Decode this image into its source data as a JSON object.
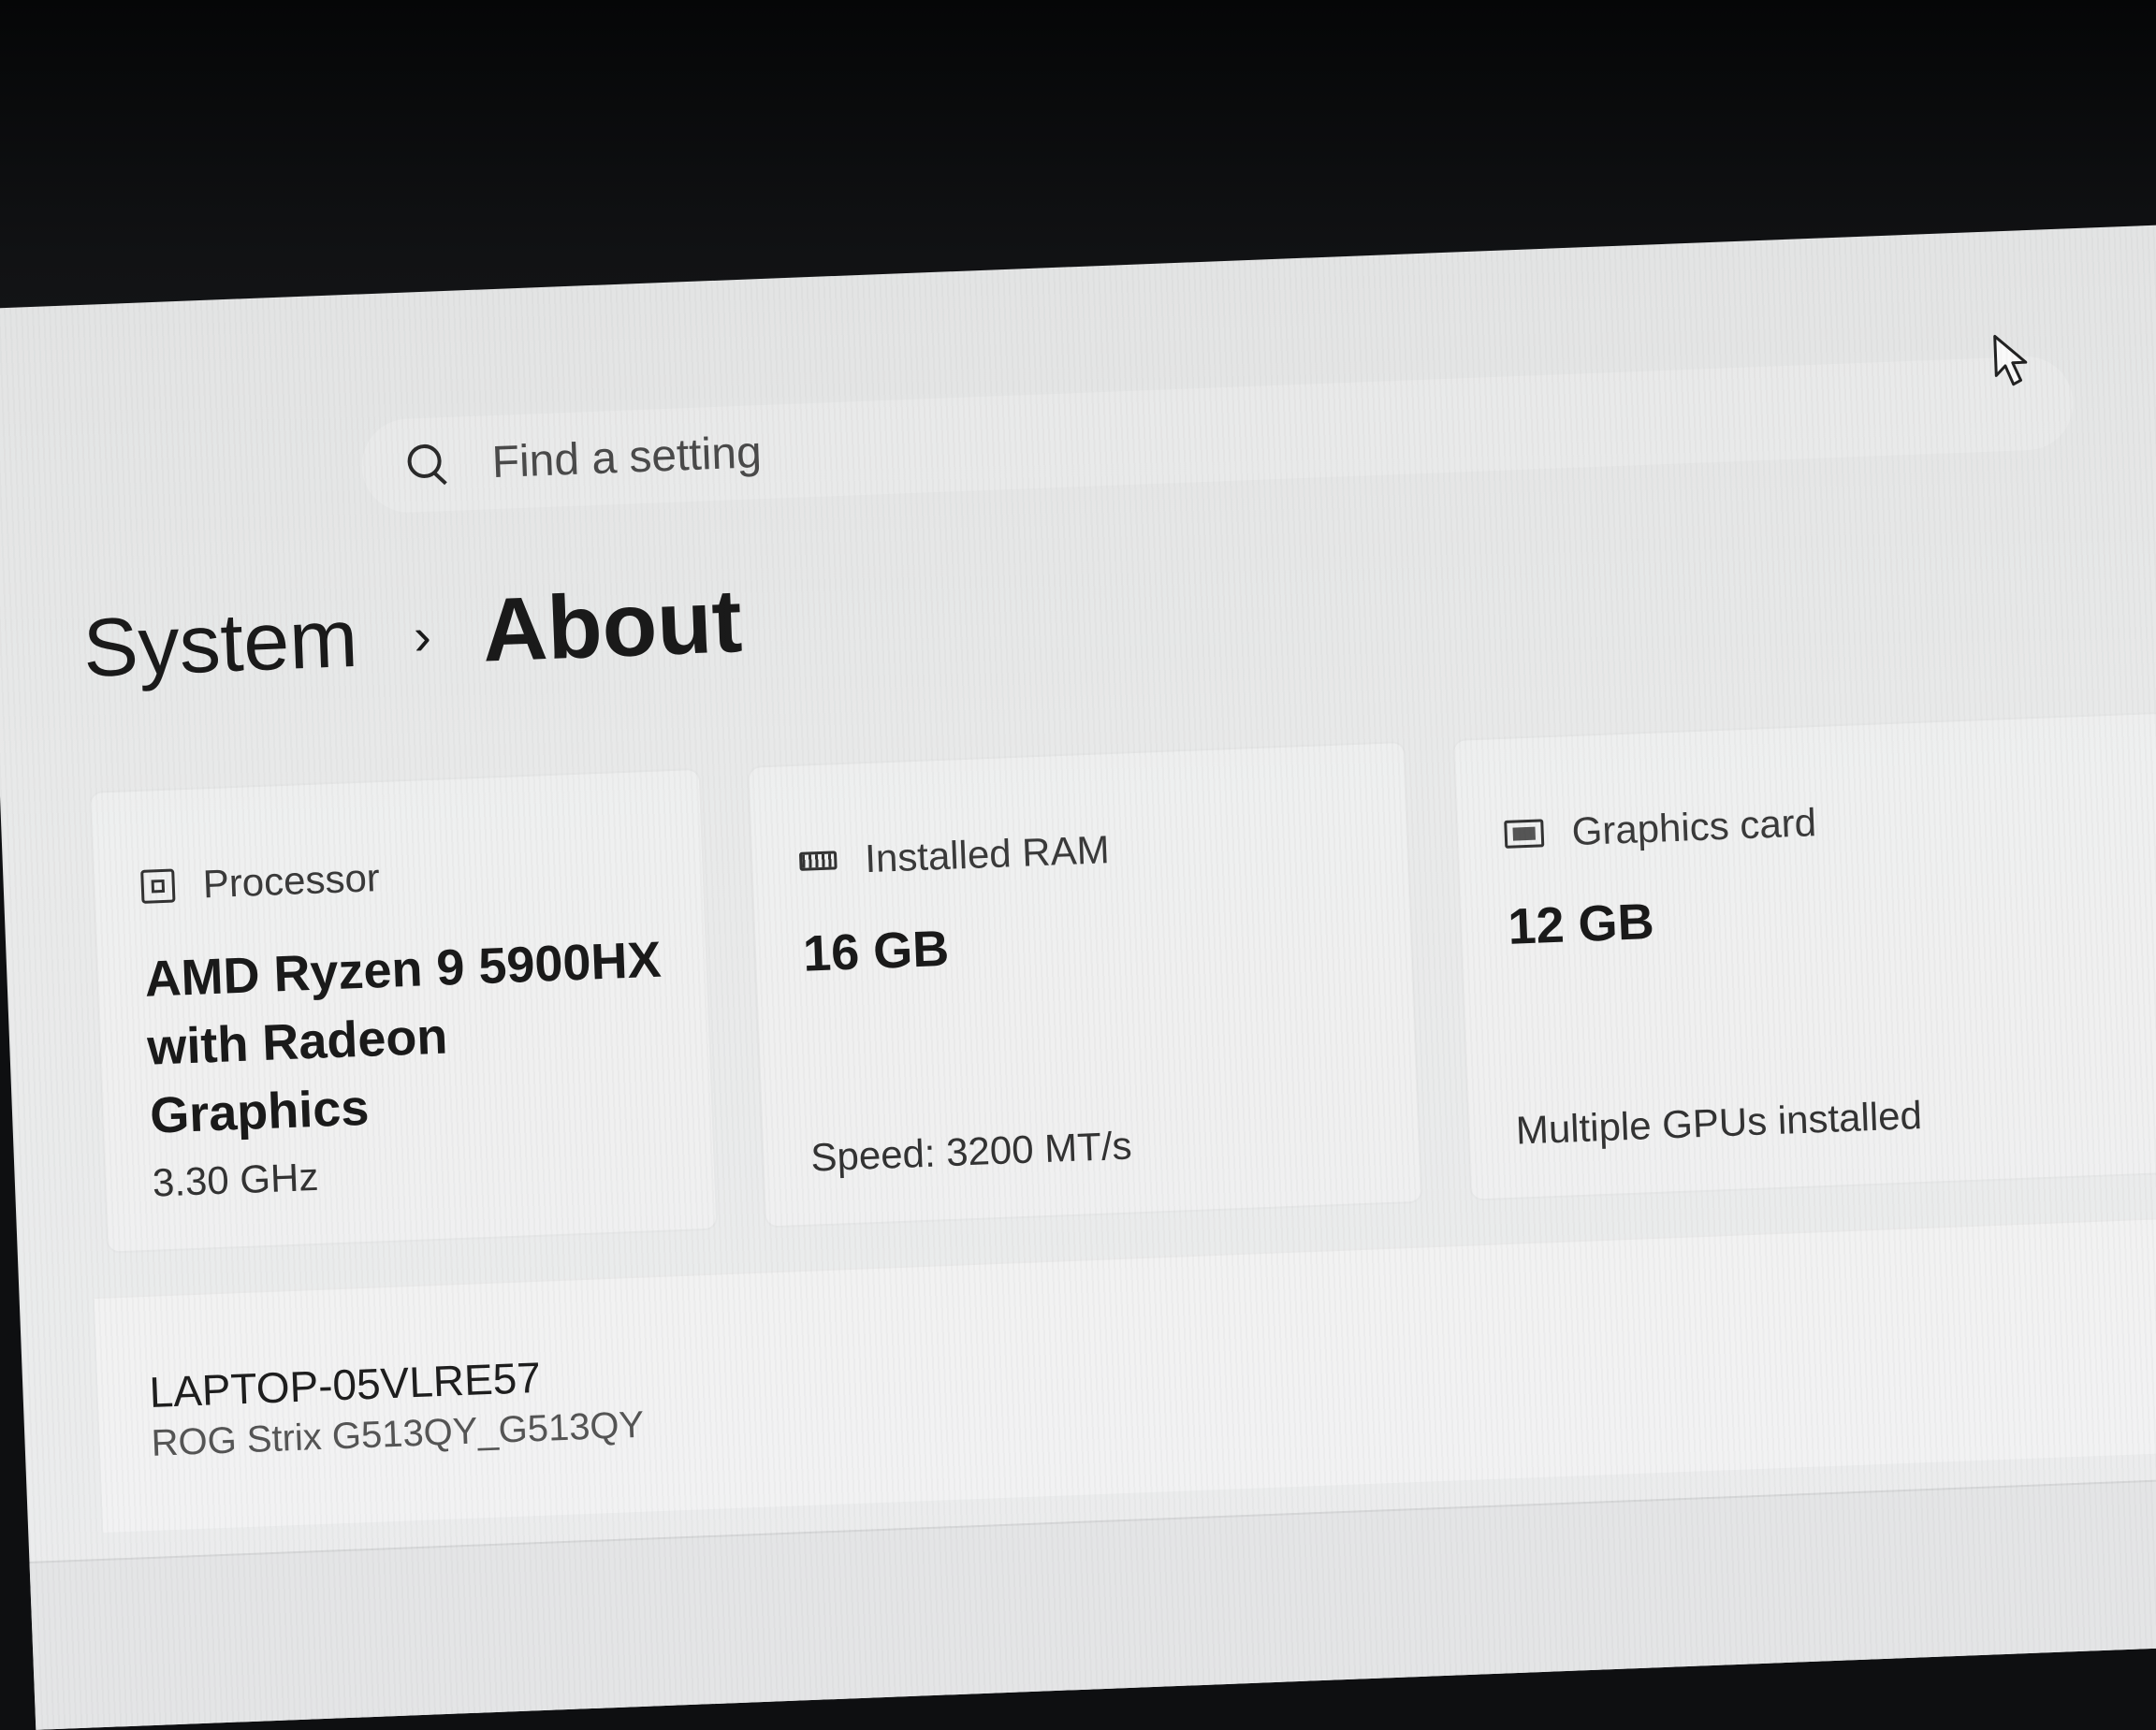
{
  "search": {
    "placeholder": "Find a setting"
  },
  "breadcrumb": {
    "parent": "System",
    "separator": "›",
    "current": "About"
  },
  "specs": {
    "processor": {
      "icon": "processor-chip-icon",
      "title": "Processor",
      "value": "AMD Ryzen 9 5900HX with Radeon Graphics",
      "sub": "3.30 GHz"
    },
    "ram": {
      "icon": "ram-module-icon",
      "title": "Installed RAM",
      "value": "16 GB",
      "sub": "Speed: 3200 MT/s"
    },
    "graphics": {
      "icon": "graphics-card-icon",
      "title": "Graphics card",
      "value": "12 GB",
      "sub": "Multiple GPUs installed"
    }
  },
  "device": {
    "name": "LAPTOP-05VLRE57",
    "model": "ROG Strix G513QY_G513QY"
  }
}
